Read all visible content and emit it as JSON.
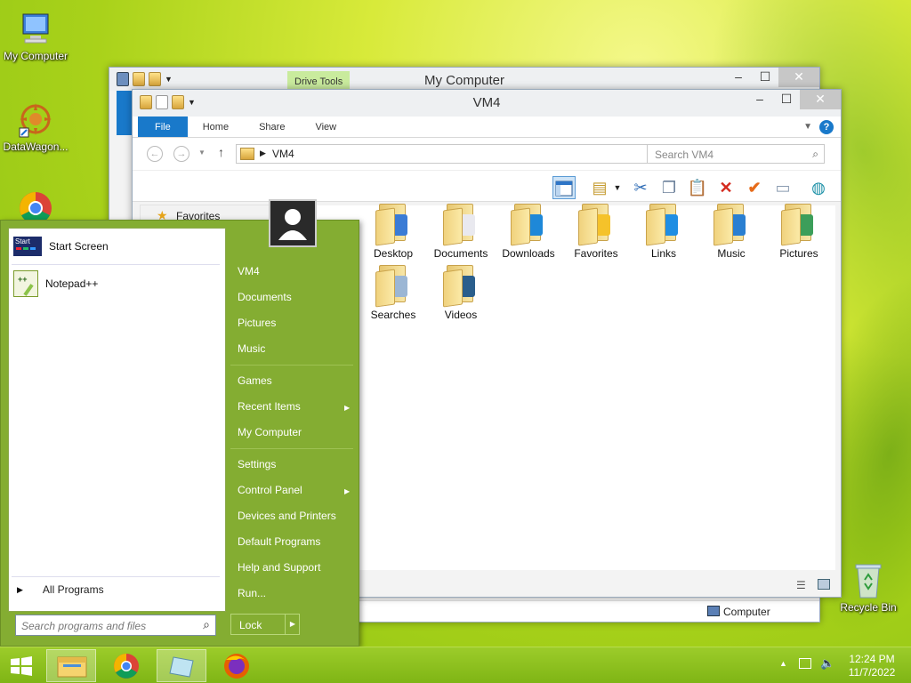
{
  "desktop": {
    "icons": [
      {
        "label": "My Computer",
        "icon": "my-computer-icon"
      },
      {
        "label": "DataWagon...",
        "icon": "datawagon-icon"
      },
      {
        "label": "Recycle Bin",
        "icon": "recycle-bin-icon"
      }
    ]
  },
  "back_window": {
    "title": "My Computer",
    "contextual_tab": "Drive Tools",
    "status_item": "Computer"
  },
  "window": {
    "title": "VM4",
    "tabs": [
      "File",
      "Home",
      "Share",
      "View"
    ],
    "address": "VM4",
    "search_placeholder": "Search VM4",
    "nav_favorites": "Favorites",
    "folders": [
      {
        "label": "Desktop",
        "icon": "desktop-folder-icon",
        "accent": "#3a7bd5"
      },
      {
        "label": "Documents",
        "icon": "documents-folder-icon",
        "accent": "#e9e9ef"
      },
      {
        "label": "Downloads",
        "icon": "downloads-folder-icon",
        "accent": "#1e88d8"
      },
      {
        "label": "Favorites",
        "icon": "favorites-folder-icon",
        "accent": "#f5c22a"
      },
      {
        "label": "Links",
        "icon": "links-folder-icon",
        "accent": "#1f8ee3"
      },
      {
        "label": "Music",
        "icon": "music-folder-icon",
        "accent": "#2a7fd1"
      },
      {
        "label": "Pictures",
        "icon": "pictures-folder-icon",
        "accent": "#3c9e5a"
      },
      {
        "label": "Searches",
        "icon": "searches-folder-icon",
        "accent": "#9bb6d4"
      },
      {
        "label": "Videos",
        "icon": "videos-folder-icon",
        "accent": "#2a5e8c"
      }
    ]
  },
  "start_menu": {
    "pinned": [
      {
        "label": "Start Screen",
        "icon": "start-screen-icon"
      },
      {
        "label": "Notepad++",
        "icon": "notepadpp-icon"
      }
    ],
    "all_programs": "All Programs",
    "search_placeholder": "Search programs and files",
    "right_items": [
      "VM4",
      "Documents",
      "Pictures",
      "Music",
      "Games",
      "Recent Items",
      "My Computer",
      "Settings",
      "Control Panel",
      "Devices and Printers",
      "Default Programs",
      "Help and Support",
      "Run..."
    ],
    "lock_label": "Lock",
    "start_icon_label": "Start"
  },
  "taskbar": {
    "time": "12:24 PM",
    "date": "11/7/2022"
  },
  "colors": {
    "ribbon_file": "#1979ca",
    "start_menu_bg": "#84ad32",
    "taskbar": "#8cc020"
  }
}
